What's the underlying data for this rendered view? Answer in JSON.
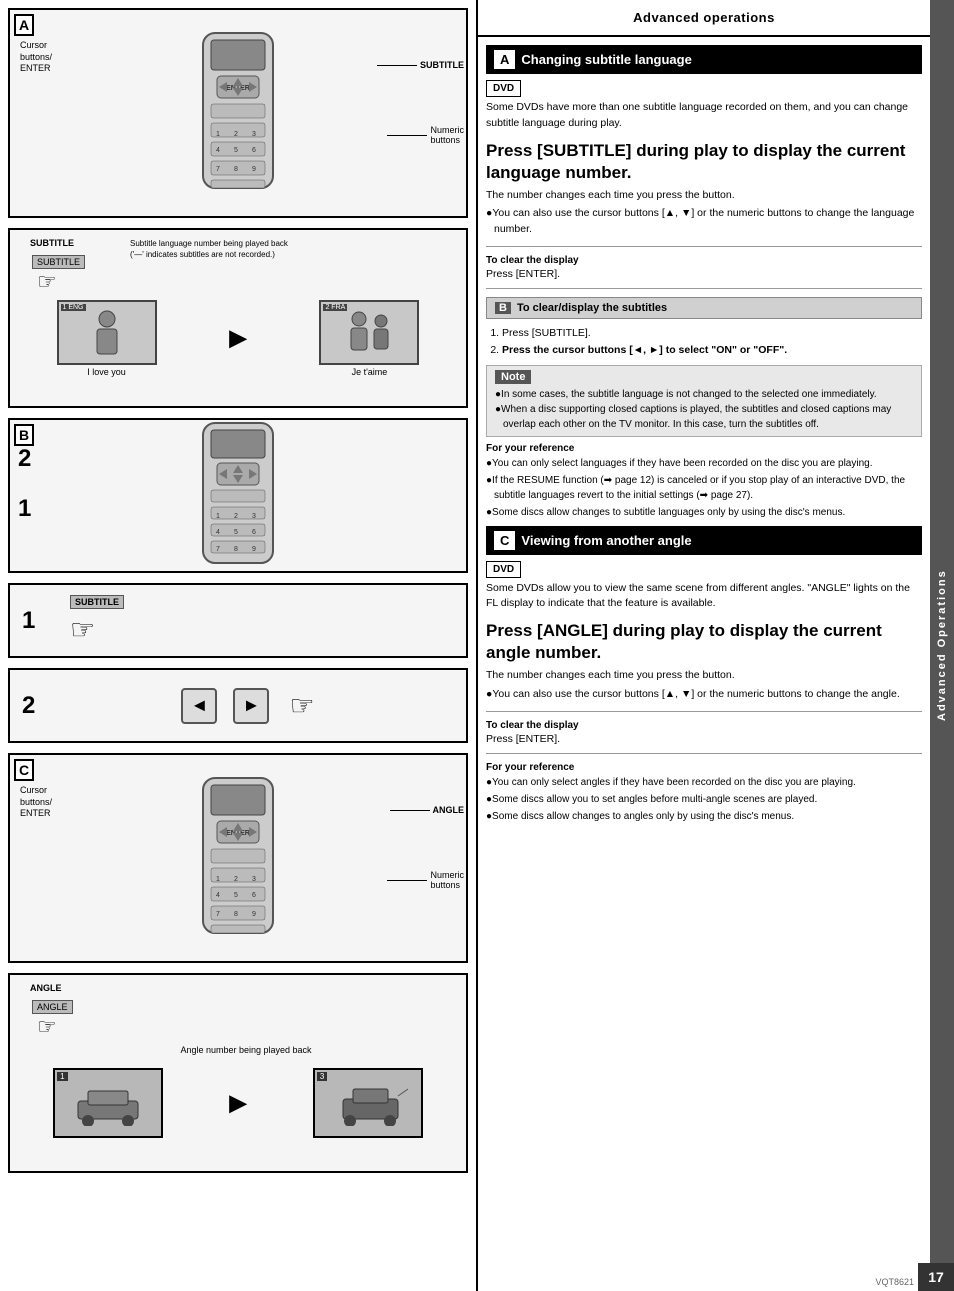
{
  "page": {
    "title": "Advanced operations",
    "page_number": "17",
    "vqt_code": "VQT8621"
  },
  "left_panel": {
    "section_A": {
      "label": "A",
      "callouts": {
        "cursor": "Cursor\nbuttons/\nENTER",
        "subtitle": "SUBTITLE",
        "numeric": "Numeric\nbuttons"
      }
    },
    "section_subtitle_illus": {
      "left_label": "SUBTITLE",
      "description": "Subtitle language number being played back\n('—' indicates subtitles are not recorded.)",
      "left_scene": "I love you",
      "right_scene": "Je t'aime"
    },
    "section_B": {
      "label": "B",
      "step1": {
        "number": "1",
        "label": "SUBTITLE"
      },
      "step2": {
        "number": "2"
      }
    },
    "section_C": {
      "label": "C",
      "callouts": {
        "cursor": "Cursor\nbuttons/\nENTER",
        "angle": "ANGLE",
        "numeric": "Numeric\nbuttons"
      }
    },
    "section_angle_illus": {
      "label": "ANGLE",
      "description": "Angle number being played back"
    }
  },
  "right_panel": {
    "header": "Advanced operations",
    "side_tab": "Advanced Operations",
    "section_A": {
      "label": "A",
      "title": "Changing subtitle language",
      "dvd_badge": "DVD",
      "intro": "Some DVDs have more than one subtitle language recorded on them, and you can change subtitle language during play.",
      "main_instruction": "Press [SUBTITLE] during play to display the current language number.",
      "sub_text": "The number changes each time you press the button.",
      "bullet1": "●You can also use the cursor buttons [▲, ▼] or the numeric buttons to change the language number.",
      "divider1": true,
      "clear_display_label": "To clear the display",
      "clear_display_text": "Press [ENTER].",
      "divider2": true
    },
    "section_B": {
      "label": "B",
      "title": "To clear/display the subtitles",
      "step1": "Press [SUBTITLE].",
      "step2": "Press the cursor buttons [◄, ►] to select \"ON\" or \"OFF\".",
      "note_label": "Note",
      "notes": [
        "●In some cases, the subtitle language is not changed to the selected one immediately.",
        "●When a disc supporting closed captions is played, the subtitles and closed captions may overlap each other on the TV monitor. In this case, turn the subtitles off."
      ],
      "for_reference_label": "For your reference",
      "references": [
        "●You can only select languages if they have been recorded on the disc you are playing.",
        "●If the RESUME function (➡ page 12) is canceled or if you stop play of an interactive DVD, the subtitle languages revert to the initial settings (➡ page 27).",
        "●Some discs allow changes to subtitle languages only by using the disc's menus."
      ]
    },
    "section_C": {
      "label": "C",
      "title": "Viewing from another angle",
      "dvd_badge": "DVD",
      "intro": "Some DVDs allow you to view the same scene from different angles. \"ANGLE\" lights on the FL display to indicate that the feature is available.",
      "main_instruction": "Press [ANGLE] during play to display the current angle number.",
      "sub_text": "The number changes each time you press the button.",
      "bullet1": "●You can also use the cursor buttons [▲, ▼] or the numeric buttons to change the angle.",
      "divider1": true,
      "clear_display_label": "To clear the display",
      "clear_display_text": "Press [ENTER].",
      "divider2": true,
      "for_reference_label": "For your reference",
      "references": [
        "●You can only select angles if they have been recorded on the disc you are playing.",
        "●Some discs allow you to set angles before multi-angle scenes are played.",
        "●Some discs allow changes to angles only by using the disc's menus."
      ]
    }
  }
}
